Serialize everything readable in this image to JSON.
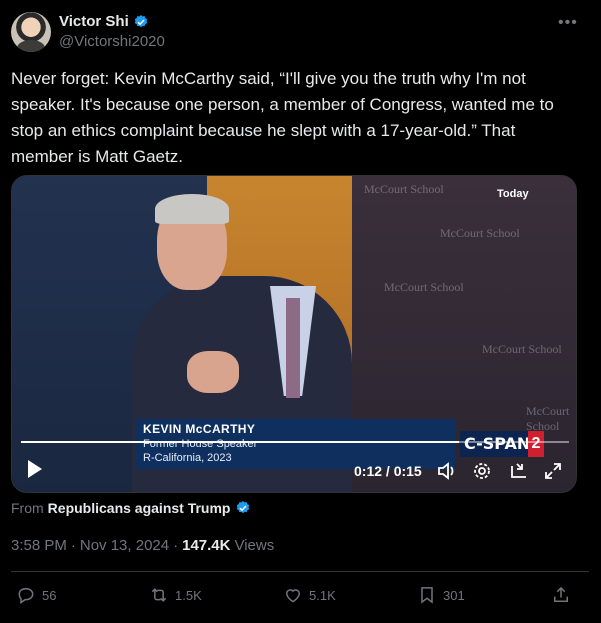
{
  "author": {
    "display_name": "Victor Shi",
    "handle": "@Victorshi2020",
    "verified": true
  },
  "tweet": {
    "text": "Never forget: Kevin McCarthy said, “I'll give you the truth why I'm not speaker. It's because one person, a member of Congress, wanted me to stop an ethics complaint because he slept with a 17-year-old.” That member is Matt Gaetz."
  },
  "video": {
    "badge_today": "Today",
    "lower_third": {
      "name": "KEVIN McCARTHY",
      "title": "Former House Speaker",
      "subtitle": "R-California, 2023"
    },
    "network": "C-SPAN",
    "network_number": "2",
    "wall_text": [
      "McCourt School",
      "McCourt School",
      "McCourt School",
      "McCourt School",
      "McCourt School"
    ],
    "time_display": "0:12 / 0:15",
    "progress": 0.8
  },
  "attribution": {
    "prefix": "From",
    "source": "Republicans against Trump",
    "verified": true
  },
  "meta": {
    "time": "3:58 PM",
    "separator": "·",
    "date": "Nov 13, 2024",
    "views_count": "147.4K",
    "views_label": "Views"
  },
  "actions": {
    "replies": "56",
    "reposts": "1.5K",
    "likes": "5.1K",
    "bookmarks": "301"
  },
  "colors": {
    "background": "#000000",
    "text": "#e7e9ea",
    "muted": "#71767b",
    "verified_blue": "#1d9bf0",
    "divider": "#2f3336"
  },
  "icons": [
    "verified-badge-icon",
    "more-icon",
    "play-icon",
    "volume-icon",
    "settings-icon",
    "pip-icon",
    "fullscreen-icon",
    "reply-icon",
    "repost-icon",
    "like-icon",
    "bookmark-icon",
    "share-icon"
  ]
}
